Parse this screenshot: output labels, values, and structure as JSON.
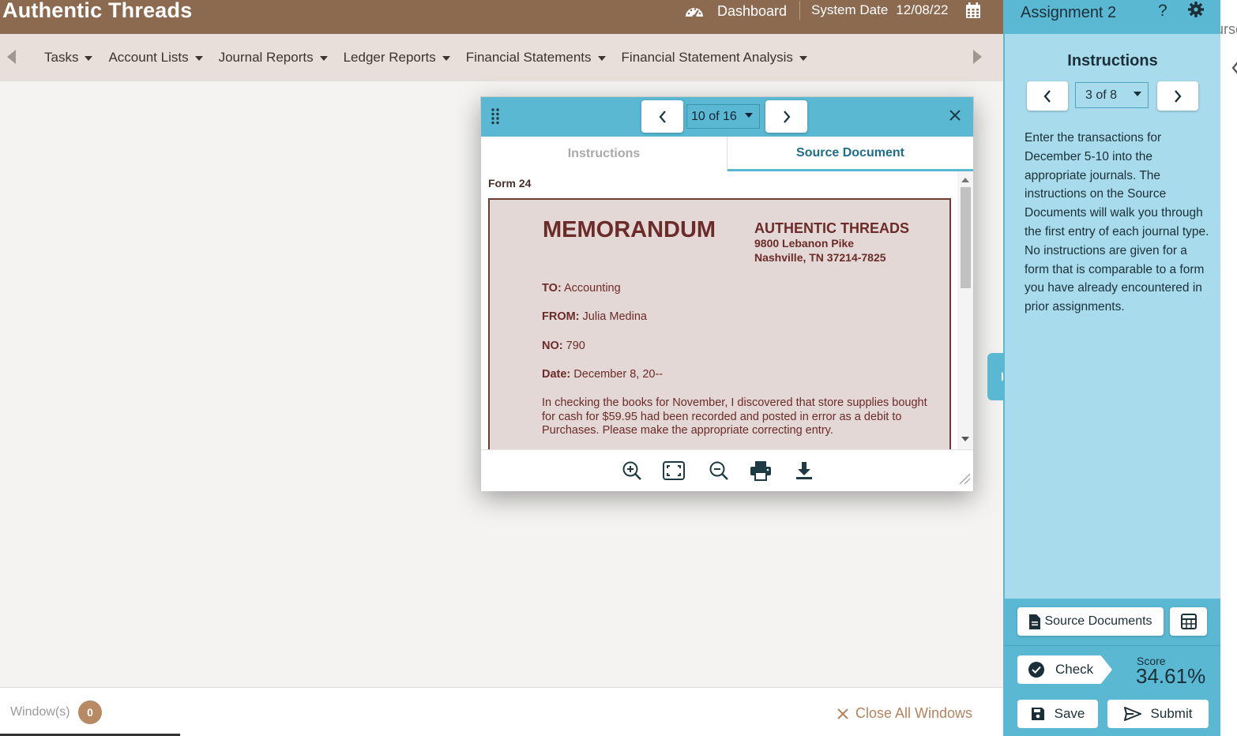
{
  "app": {
    "title": "Authentic Threads"
  },
  "header": {
    "dashboard_label": "Dashboard",
    "system_date_label": "System Date",
    "system_date_value": "12/08/22"
  },
  "nav": {
    "items": [
      {
        "label": "Tasks"
      },
      {
        "label": "Account Lists"
      },
      {
        "label": "Journal Reports"
      },
      {
        "label": "Ledger Reports"
      },
      {
        "label": "Financial Statements"
      },
      {
        "label": "Financial Statement Analysis"
      }
    ]
  },
  "modal": {
    "page_indicator": "10 of 16",
    "tabs": [
      {
        "label": "Instructions",
        "active": false
      },
      {
        "label": "Source Document",
        "active": true
      }
    ],
    "form_label": "Form 24",
    "memo": {
      "title": "MEMORANDUM",
      "company": "AUTHENTIC THREADS",
      "address_line1": "9800 Lebanon Pike",
      "address_line2": "Nashville, TN 37214-7825",
      "to_label": "TO:",
      "to_value": "Accounting",
      "from_label": "FROM:",
      "from_value": "Julia Medina",
      "no_label": "NO:",
      "no_value": "790",
      "date_label": "Date:",
      "date_value": "December 8, 20--",
      "body": "In checking the books for November, I discovered that store supplies bought for cash for $59.95 had been recorded and posted in error as a debit to Purchases. Please make the appropriate correcting entry."
    },
    "tools": [
      "zoom-in-icon",
      "fit-page-icon",
      "zoom-out-icon",
      "print-icon",
      "download-icon"
    ]
  },
  "footer": {
    "windows_label": "Window(s)",
    "windows_count": "0",
    "close_all_label": "Close All Windows"
  },
  "panel": {
    "title": "Assignment 2",
    "help_label": "?",
    "instructions_title": "Instructions",
    "page_indicator": "3 of 8",
    "instructions_text": "Enter the transactions for December 5-10 into the appropriate journals. The instructions on the Source Documents will walk you through the first entry of each journal type. No instructions are given for a form that is comparable to a form you have already encountered in prior assignments.",
    "source_documents_label": "Source Documents",
    "check_label": "Check",
    "score_label": "Score",
    "score_value": "34.61%",
    "save_label": "Save",
    "submit_label": "Submit"
  },
  "edge_text": "urse",
  "colors": {
    "header_brown": "#8c6a50",
    "nav_bg": "#e8dfda",
    "panel_blue": "#5ab8d3",
    "panel_light_blue": "#a8dced",
    "memo_bg": "#e3d8d6",
    "memo_text": "#6b2b28",
    "badge": "#b88a64"
  }
}
